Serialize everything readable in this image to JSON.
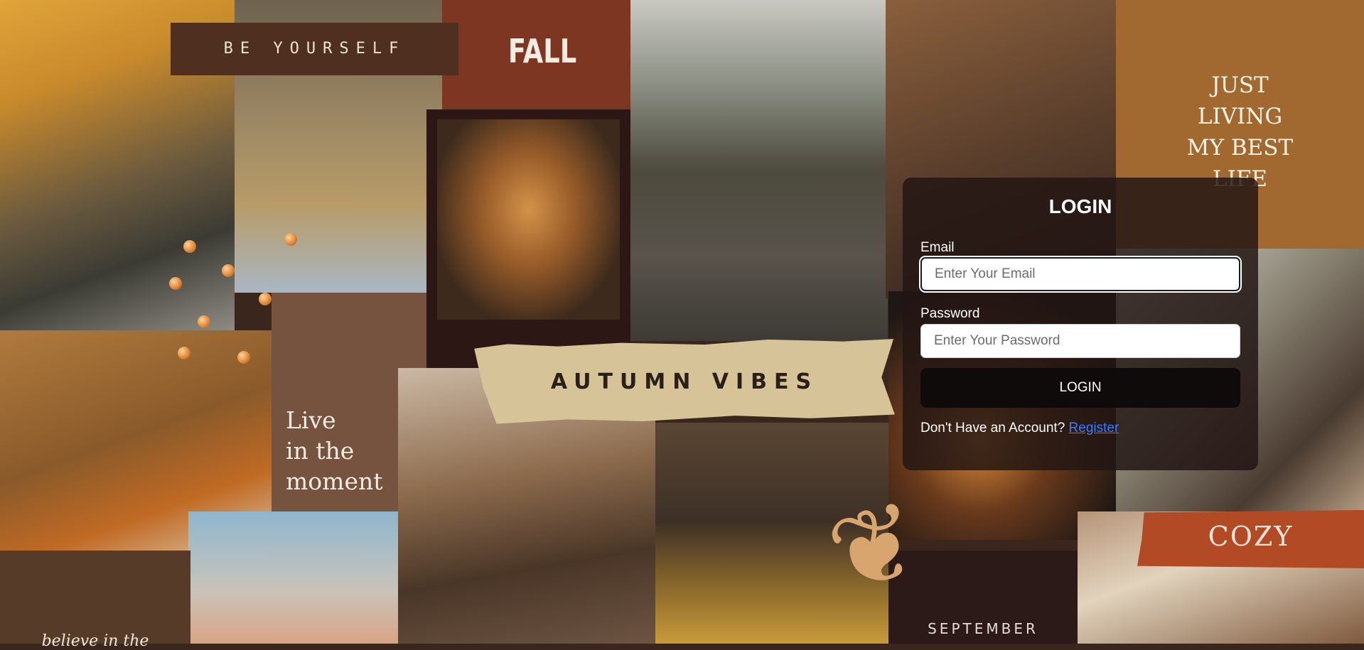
{
  "collage": {
    "be_yourself": "BE YOURSELF",
    "fall": "FALL",
    "just_living": [
      "JUST",
      "LIVING",
      "MY BEST",
      "LIFE"
    ],
    "live_in_the_moment": [
      "Live",
      "in the",
      "moment"
    ],
    "autumn_vibes": "AUTUMN VIBES",
    "cozy": "COZY",
    "september": "SEPTEMBER",
    "believe": "believe in the"
  },
  "login": {
    "title": "LOGIN",
    "email_label": "Email",
    "email_placeholder": "Enter Your Email",
    "password_label": "Password",
    "password_placeholder": "Enter Your Password",
    "button_label": "LOGIN",
    "no_account_text": "Don't Have an Account?",
    "register_label": "Register"
  },
  "icons": {
    "leaf": "maple-leaf"
  },
  "colors": {
    "panel_bg": "#221613",
    "button_bg": "#0f0b0a",
    "link": "#3d7bff",
    "fall_tile": "#7c3622",
    "cozy_tape": "#b24a25",
    "just_tile": "#a16930"
  }
}
